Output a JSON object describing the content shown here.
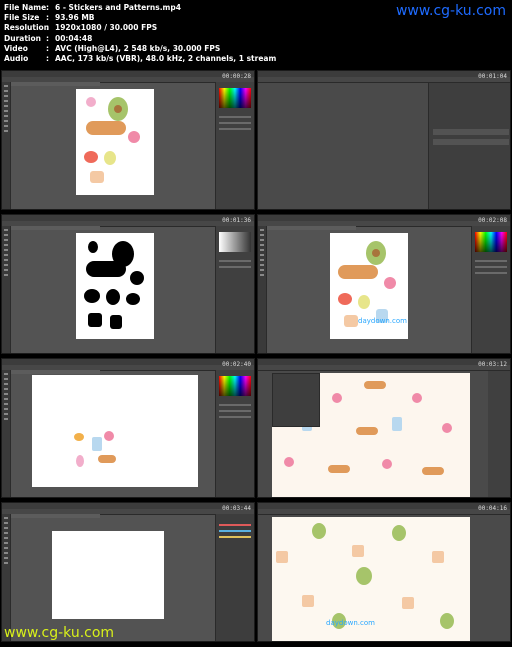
{
  "media_info": [
    {
      "label": "File Name",
      "value": "6 - Stickers and Patterns.mp4"
    },
    {
      "label": "File Size",
      "value": "93.96 MB"
    },
    {
      "label": "Resolution",
      "value": "1920x1080 / 30.000 FPS"
    },
    {
      "label": "Duration",
      "value": "00:04:48"
    },
    {
      "label": "Video",
      "value": "AVC (High@L4), 2 548 kb/s, 30.000 FPS"
    },
    {
      "label": "Audio",
      "value": "AAC, 173 kb/s (VBR), 48.0 kHz, 2 channels, 1 stream"
    }
  ],
  "watermark_top": "www.cg-ku.com",
  "watermark_bottom": "www.cg-ku.com",
  "thumb_watermark": "daydown.com",
  "thumbnails": [
    {
      "timestamp": "00:00:28"
    },
    {
      "timestamp": "00:01:04"
    },
    {
      "timestamp": "00:01:36"
    },
    {
      "timestamp": "00:02:08"
    },
    {
      "timestamp": "00:02:40"
    },
    {
      "timestamp": "00:03:12"
    },
    {
      "timestamp": "00:03:44"
    },
    {
      "timestamp": "00:04:16"
    }
  ]
}
